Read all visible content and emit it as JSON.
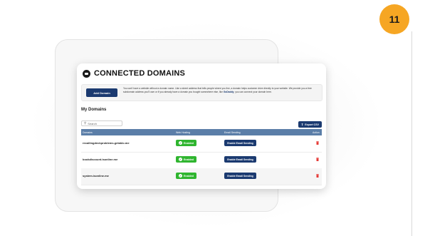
{
  "step_badge": "11",
  "header": {
    "title": "CONNECTED DOMAINS"
  },
  "notice": {
    "button_label": "Add Domain",
    "text_before": "You can't have a website without a domain name. Like a street address that tells people where you live, a domain helps customer drive directly to your website. We provide you a free subdomain address you'll own or if you already have a domain you bought somewhere else, like ",
    "link_text": "GoDaddy",
    "text_after": ", you can connect your domain here."
  },
  "domains_section": {
    "title": "My Domains",
    "search_placeholder": "Search",
    "export_label": "Export CSV",
    "columns": {
      "domain": "Domains",
      "web_hosting": "Web Hosting",
      "email_sending": "Email Sending",
      "action": "Action"
    },
    "rows": [
      {
        "domain": "recallingdeckproblems.getaklo.me",
        "web_status": "Enabled",
        "email_action": "Enable Email Sending"
      },
      {
        "domain": "bookdiscount.isonline.me",
        "web_status": "Enabled",
        "email_action": "Enable Email Sending"
      },
      {
        "domain": "system.isonline.me",
        "web_status": "Enabled",
        "email_action": "Enable Email Sending"
      }
    ]
  },
  "colors": {
    "badge": "#f6a623",
    "primary": "#1b3a70",
    "table_header": "#5b7ea8",
    "enabled": "#2fb52f",
    "delete": "#e53935"
  },
  "icons": [
    "globe-icon",
    "search-icon",
    "upload-icon",
    "check-icon",
    "trash-icon"
  ]
}
